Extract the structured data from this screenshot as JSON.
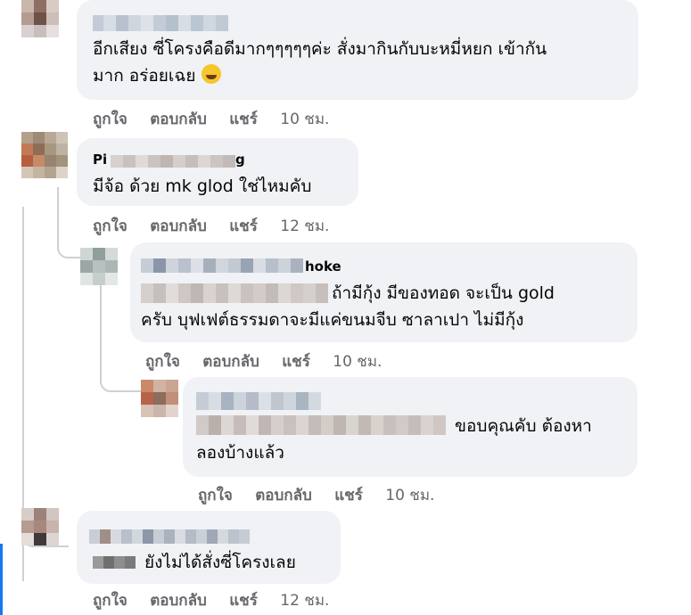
{
  "comments": [
    {
      "id": "c1",
      "author_visible": "",
      "text_lines": [
        "อีกเสียง ซี่โครงคือดีมากๆๆๆๆๆค่ะ สั่งมากินกับบะหมี่หยก เข้ากัน",
        "มาก อร่อยเฉย"
      ],
      "emoji_icon": "rolling-laughing-emoji-icon",
      "actions": {
        "like": "ถูกใจ",
        "reply": "ตอบกลับ",
        "share": "แชร์",
        "time": "10 ชม."
      }
    },
    {
      "id": "c2",
      "author_visible": "Pi",
      "author_suffix": "g",
      "text_lines": [
        "มีจ้อ ด้วย mk glod ใช่ไหมคับ"
      ],
      "actions": {
        "like": "ถูกใจ",
        "reply": "ตอบกลับ",
        "share": "แชร์",
        "time": "12 ชม."
      }
    },
    {
      "id": "c3",
      "author_visible": "hoke",
      "text_lines": [
        "ถ้ามีกุ้ง มีของทอด จะเป็น gold",
        "ครับ บุฟเฟต์ธรรมดาจะมีแค่ขนมจีบ ซาลาเปา ไม่มีกุ้ง"
      ],
      "actions": {
        "like": "ถูกใจ",
        "reply": "ตอบกลับ",
        "share": "แชร์",
        "time": "10 ชม."
      }
    },
    {
      "id": "c4",
      "author_visible": "",
      "text_lines": [
        "ขอบคุณคับ ต้องหา",
        "ลองบ้างแล้ว"
      ],
      "actions": {
        "like": "ถูกใจ",
        "reply": "ตอบกลับ",
        "share": "แชร์",
        "time": "10 ชม."
      }
    },
    {
      "id": "c5",
      "author_visible": "",
      "text_lines": [
        "ยังไม่ได้สั่งซี่โครงเลย"
      ],
      "actions": {
        "like": "ถูกใจ",
        "reply": "ตอบกลับ",
        "share": "แชร์",
        "time": "12 ชม."
      }
    }
  ],
  "colors": {
    "bubble": "#f0f2f5",
    "action_text": "#65676b",
    "thread_line": "#ced0d4",
    "accent": "#1877f2"
  }
}
